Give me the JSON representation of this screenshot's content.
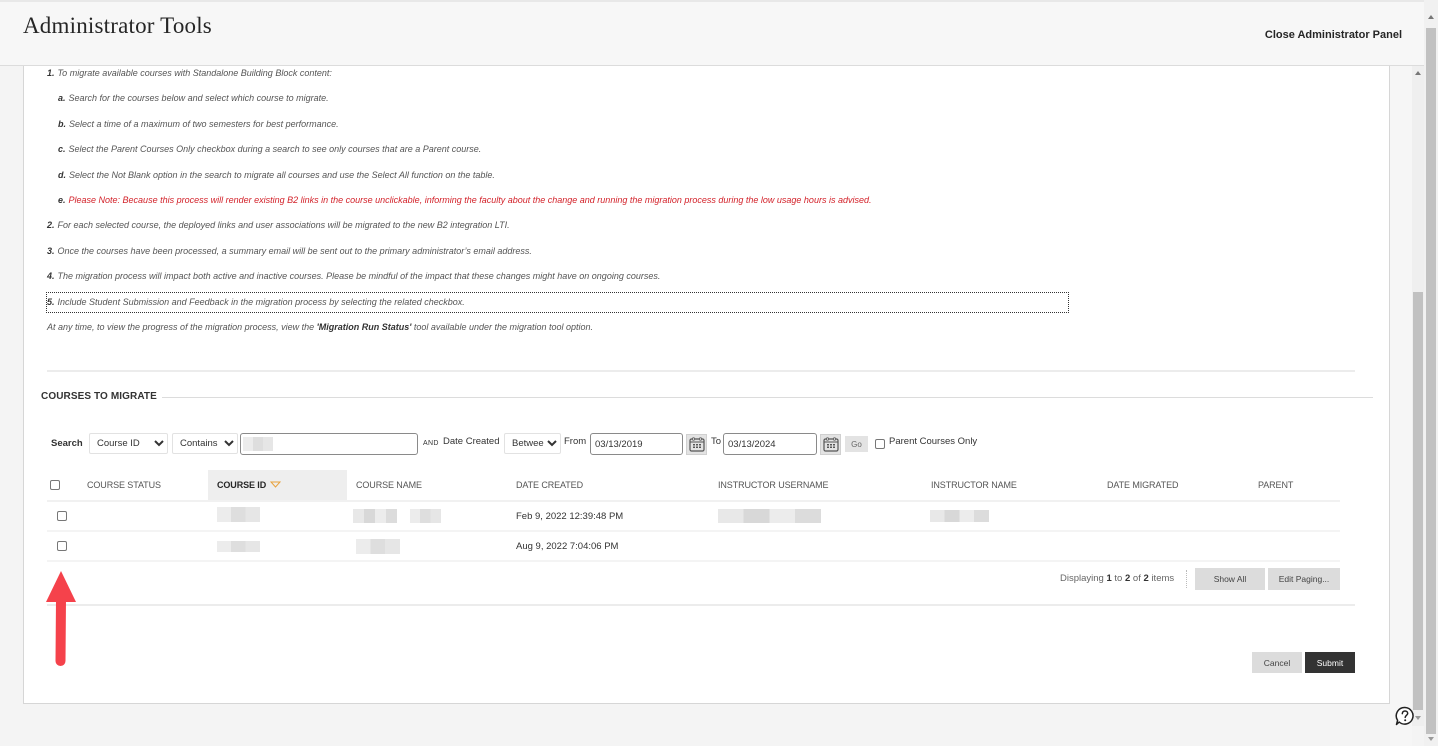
{
  "header": {
    "title": "Administrator Tools",
    "close_label": "Close Administrator Panel"
  },
  "instructions": {
    "items": [
      {
        "marker": "1.",
        "text": "To migrate available courses with Standalone Building Block content:",
        "level": 0
      },
      {
        "marker": "a.",
        "text": "Search for the courses below and select which course to migrate.",
        "level": 1
      },
      {
        "marker": "b.",
        "text": "Select a time of a maximum of two semesters for best performance.",
        "level": 1
      },
      {
        "marker": "c.",
        "text": "Select the Parent Courses Only checkbox during a search to see only courses that are a Parent course.",
        "level": 1
      },
      {
        "marker": "d.",
        "text": "Select the Not Blank option in the search to migrate all courses and use the Select All function on the table.",
        "level": 1
      },
      {
        "marker": "e.",
        "text": "Please Note: Because this process will render existing B2 links in the course unclickable, informing the faculty about the change and running the migration process during the low usage hours is advised.",
        "level": 1,
        "style": "warning"
      },
      {
        "marker": "2.",
        "text": "For each selected course, the deployed links and user associations will be migrated to the new B2 integration LTI.",
        "level": 0
      },
      {
        "marker": "3.",
        "text": "Once the courses have been processed, a summary email will be sent out to the primary administrator’s email address.",
        "level": 0
      },
      {
        "marker": "4.",
        "text": "The migration process will impact both active and inactive courses. Please be mindful of the impact that these changes might have on ongoing courses.",
        "level": 0
      },
      {
        "marker": "5.",
        "text": "Include Student Submission and Feedback in the migration process by selecting the related checkbox.",
        "level": 0,
        "focused": true
      }
    ],
    "note": {
      "before": "At any time, to view the progress of the migration process, view the ",
      "emphasis": "'Migration Run Status'",
      "after": " tool available under the migration tool option."
    }
  },
  "section": {
    "title": "COURSES TO MIGRATE"
  },
  "search": {
    "label": "Search",
    "field_selected": "Course ID",
    "operator_selected": "Contains",
    "value_redacted": true,
    "and_label": "AND",
    "date_label": "Date Created",
    "date_operator_selected": "Between",
    "from_label": "From",
    "from_value": "03/13/2019",
    "to_label": "To",
    "to_value": "03/13/2024",
    "go_label": "Go",
    "parent_only_label": "Parent Courses Only",
    "parent_only_checked": false
  },
  "table": {
    "select_all_checked": false,
    "columns": [
      "COURSE STATUS",
      "COURSE ID",
      "COURSE NAME",
      "DATE CREATED",
      "INSTRUCTOR USERNAME",
      "INSTRUCTOR NAME",
      "DATE MIGRATED",
      "PARENT"
    ],
    "sorted_column": "COURSE ID",
    "sort_direction": "descending",
    "rows": [
      {
        "checked": false,
        "course_status": "",
        "course_id_redacted": true,
        "course_name_redacted": true,
        "date_created": "Feb 9, 2022 12:39:48 PM",
        "instructor_username_redacted": true,
        "instructor_name_redacted": true,
        "date_migrated": "",
        "parent": ""
      },
      {
        "checked": false,
        "course_status": "",
        "course_id_redacted": true,
        "course_name_redacted": true,
        "date_created": "Aug 9, 2022 7:04:06 PM",
        "instructor_username": "",
        "instructor_name": "",
        "date_migrated": "",
        "parent": ""
      }
    ]
  },
  "paging": {
    "prefix": "Displaying",
    "start": "1",
    "to": "to",
    "end": "2",
    "of": "of",
    "total": "2",
    "suffix": "items",
    "show_all_label": "Show All",
    "edit_paging_label": "Edit Paging..."
  },
  "actions": {
    "cancel_label": "Cancel",
    "submit_label": "Submit"
  },
  "annotation": {
    "type": "arrow",
    "direction": "up",
    "target": "select-all-checkbox",
    "color": "#f5424b"
  },
  "colors": {
    "warning_text": "#d3222a",
    "submit_bg": "#333333",
    "sort_indicator": "#e8a23c"
  }
}
